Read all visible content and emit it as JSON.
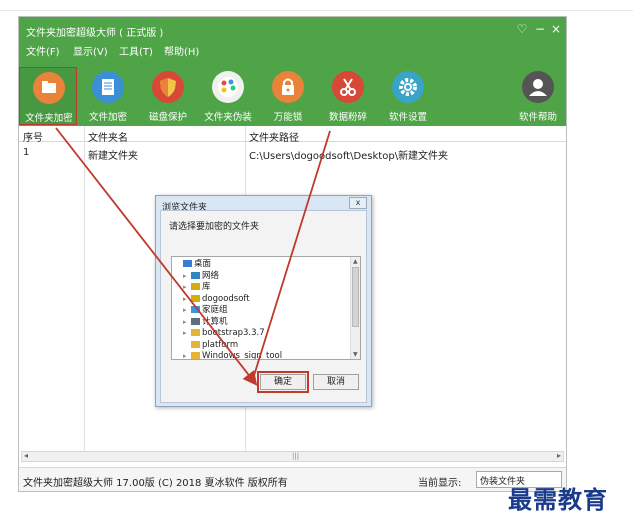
{
  "window": {
    "title": "文件夹加密超级大师 ( 正式版 )",
    "controls": {
      "skin": "♡",
      "minimize": "−",
      "close": "×"
    }
  },
  "menu": [
    "文件(F)",
    "显示(V)",
    "工具(T)",
    "帮助(H)"
  ],
  "toolbar": [
    {
      "label": "文件夹加密",
      "icon": "folder-icon",
      "color": "#e9833a",
      "active": true
    },
    {
      "label": "文件加密",
      "icon": "document-icon",
      "color": "#3b8fd6",
      "active": false
    },
    {
      "label": "磁盘保护",
      "icon": "shield-icon",
      "color": "#d84836",
      "active": false
    },
    {
      "label": "文件夹伪装",
      "icon": "palette-icon",
      "color": "#f0f0f0",
      "active": false
    },
    {
      "label": "万能锁",
      "icon": "lock-icon",
      "color": "#e9833a",
      "active": false
    },
    {
      "label": "数据粉碎",
      "icon": "scissors-icon",
      "color": "#d84836",
      "active": false
    },
    {
      "label": "软件设置",
      "icon": "gear-icon",
      "color": "#3aa3c9",
      "active": false
    },
    {
      "label": "软件帮助",
      "icon": "user-icon",
      "color": "#555555",
      "active": false
    }
  ],
  "table": {
    "columns": [
      "序号",
      "文件夹名",
      "文件夹路径"
    ],
    "rows": [
      [
        "1",
        "新建文件夹",
        "C:\\Users\\dogoodsoft\\Desktop\\新建文件夹"
      ]
    ]
  },
  "scrollbar": {
    "left": "◂",
    "right": "▸",
    "thumb": "|||"
  },
  "status": {
    "text": "文件夹加密超级大师 17.00版 (C) 2018 夏冰软件 版权所有",
    "current_label": "当前显示:",
    "current_value": "伪装文件夹"
  },
  "dialog": {
    "title": "浏览文件夹",
    "close": "x",
    "prompt": "请选择要加密的文件夹",
    "tree": [
      {
        "label": "桌面",
        "indent": 0,
        "expander": "",
        "icon": "desktop-icon"
      },
      {
        "label": "网络",
        "indent": 1,
        "expander": "▸",
        "icon": "network-icon"
      },
      {
        "label": "库",
        "indent": 1,
        "expander": "▸",
        "icon": "library-icon"
      },
      {
        "label": "dogoodsoft",
        "indent": 1,
        "expander": "▸",
        "icon": "user-folder-icon"
      },
      {
        "label": "家庭组",
        "indent": 1,
        "expander": "▸",
        "icon": "homegroup-icon"
      },
      {
        "label": "计算机",
        "indent": 1,
        "expander": "▸",
        "icon": "computer-icon"
      },
      {
        "label": "bootstrap3.3.7",
        "indent": 1,
        "expander": "▸",
        "icon": "folder-icon"
      },
      {
        "label": "platform",
        "indent": 1,
        "expander": "",
        "icon": "folder-icon"
      },
      {
        "label": "Windows_sign_tool",
        "indent": 1,
        "expander": "▸",
        "icon": "folder-icon"
      }
    ],
    "ok": "确定",
    "cancel": "取消"
  },
  "watermark": "最需教育"
}
